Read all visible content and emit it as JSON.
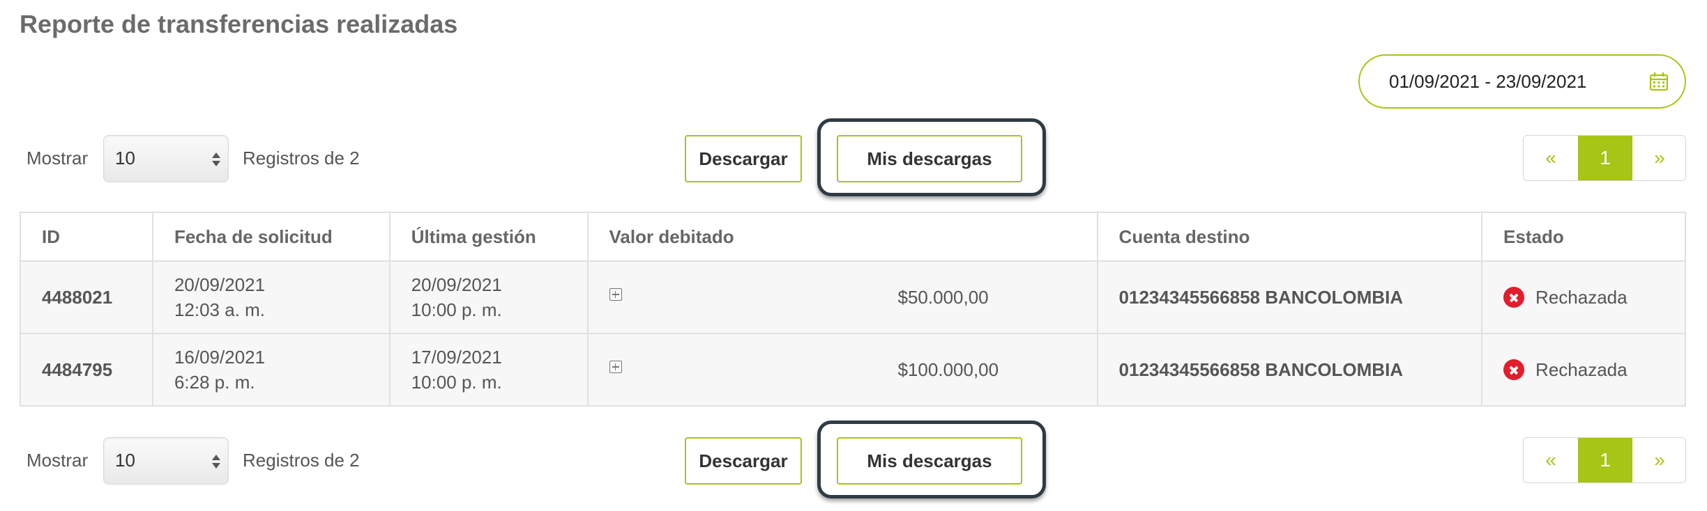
{
  "page": {
    "title": "Reporte de transferencias realizadas"
  },
  "filter": {
    "date_range": "01/09/2021 - 23/09/2021",
    "icon": "calendar-icon"
  },
  "controls": {
    "show_label": "Mostrar",
    "page_size": "10",
    "records_label": "Registros de 2",
    "download_label": "Descargar",
    "my_downloads_label": "Mis descargas",
    "pagination": {
      "prev": "«",
      "current": "1",
      "next": "»"
    }
  },
  "table": {
    "headers": [
      "ID",
      "Fecha de solicitud",
      "Última gestión",
      "Valor debitado",
      "Cuenta destino",
      "Estado"
    ],
    "rows": [
      {
        "id": "4488021",
        "request_date": "20/09/2021",
        "request_time": "12:03 a. m.",
        "last_date": "20/09/2021",
        "last_time": "10:00 p. m.",
        "amount": "$50.000,00",
        "account": "01234345566858 BANCOLOMBIA",
        "status": "Rechazada"
      },
      {
        "id": "4484795",
        "request_date": "16/09/2021",
        "request_time": "6:28 p. m.",
        "last_date": "17/09/2021",
        "last_time": "10:00 p. m.",
        "amount": "$100.000,00",
        "account": "01234345566858 BANCOLOMBIA",
        "status": "Rechazada"
      }
    ]
  },
  "colors": {
    "accent": "#a6c514",
    "rejected": "#e21d2c",
    "highlight_border": "#2f3b44"
  }
}
